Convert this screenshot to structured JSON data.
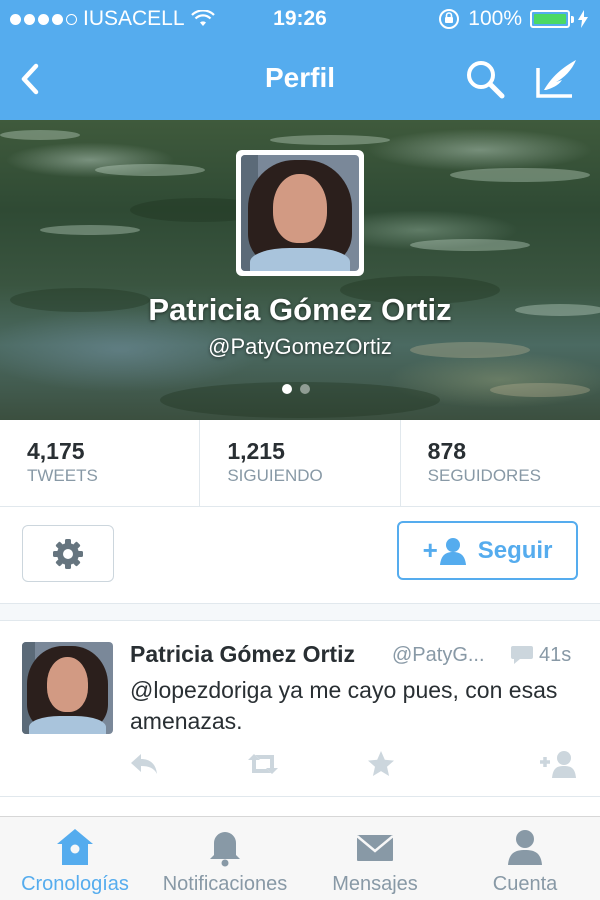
{
  "status_bar": {
    "carrier": "IUSACELL",
    "time": "19:26",
    "battery_percent": "100%",
    "battery_level": 1.0,
    "signal_bars_filled": 4,
    "signal_bars_total": 5
  },
  "nav": {
    "title": "Perfil",
    "back_icon": "chevron-left-icon",
    "search_icon": "search-icon",
    "compose_icon": "compose-tweet-icon"
  },
  "profile": {
    "name": "Patricia Gómez Ortiz",
    "handle": "@PatyGomezOrtiz",
    "page_count": 2,
    "active_page": 1
  },
  "stats": [
    {
      "value": "4,175",
      "label": "TWEETS"
    },
    {
      "value": "1,215",
      "label": "SIGUIENDO"
    },
    {
      "value": "878",
      "label": "SEGUIDORES"
    }
  ],
  "actions": {
    "settings_icon": "gear-icon",
    "follow_plus": "+",
    "follow_label": "Seguir"
  },
  "tweet": {
    "name": "Patricia Gómez Ortiz",
    "handle": "@PatyG...",
    "time": "41s",
    "text": "@lopezdoriga ya me cayo pues, con esas amenazas."
  },
  "tabs": [
    {
      "label": "Cronologías",
      "icon": "home-icon",
      "active": true
    },
    {
      "label": "Notificaciones",
      "icon": "bell-icon",
      "active": false
    },
    {
      "label": "Mensajes",
      "icon": "envelope-icon",
      "active": false
    },
    {
      "label": "Cuenta",
      "icon": "person-icon",
      "active": false
    }
  ],
  "colors": {
    "brand": "#55acee",
    "text_primary": "#292f33",
    "text_secondary": "#8899a6",
    "battery_green": "#4cd964",
    "tab_inactive": "#8899a6"
  }
}
